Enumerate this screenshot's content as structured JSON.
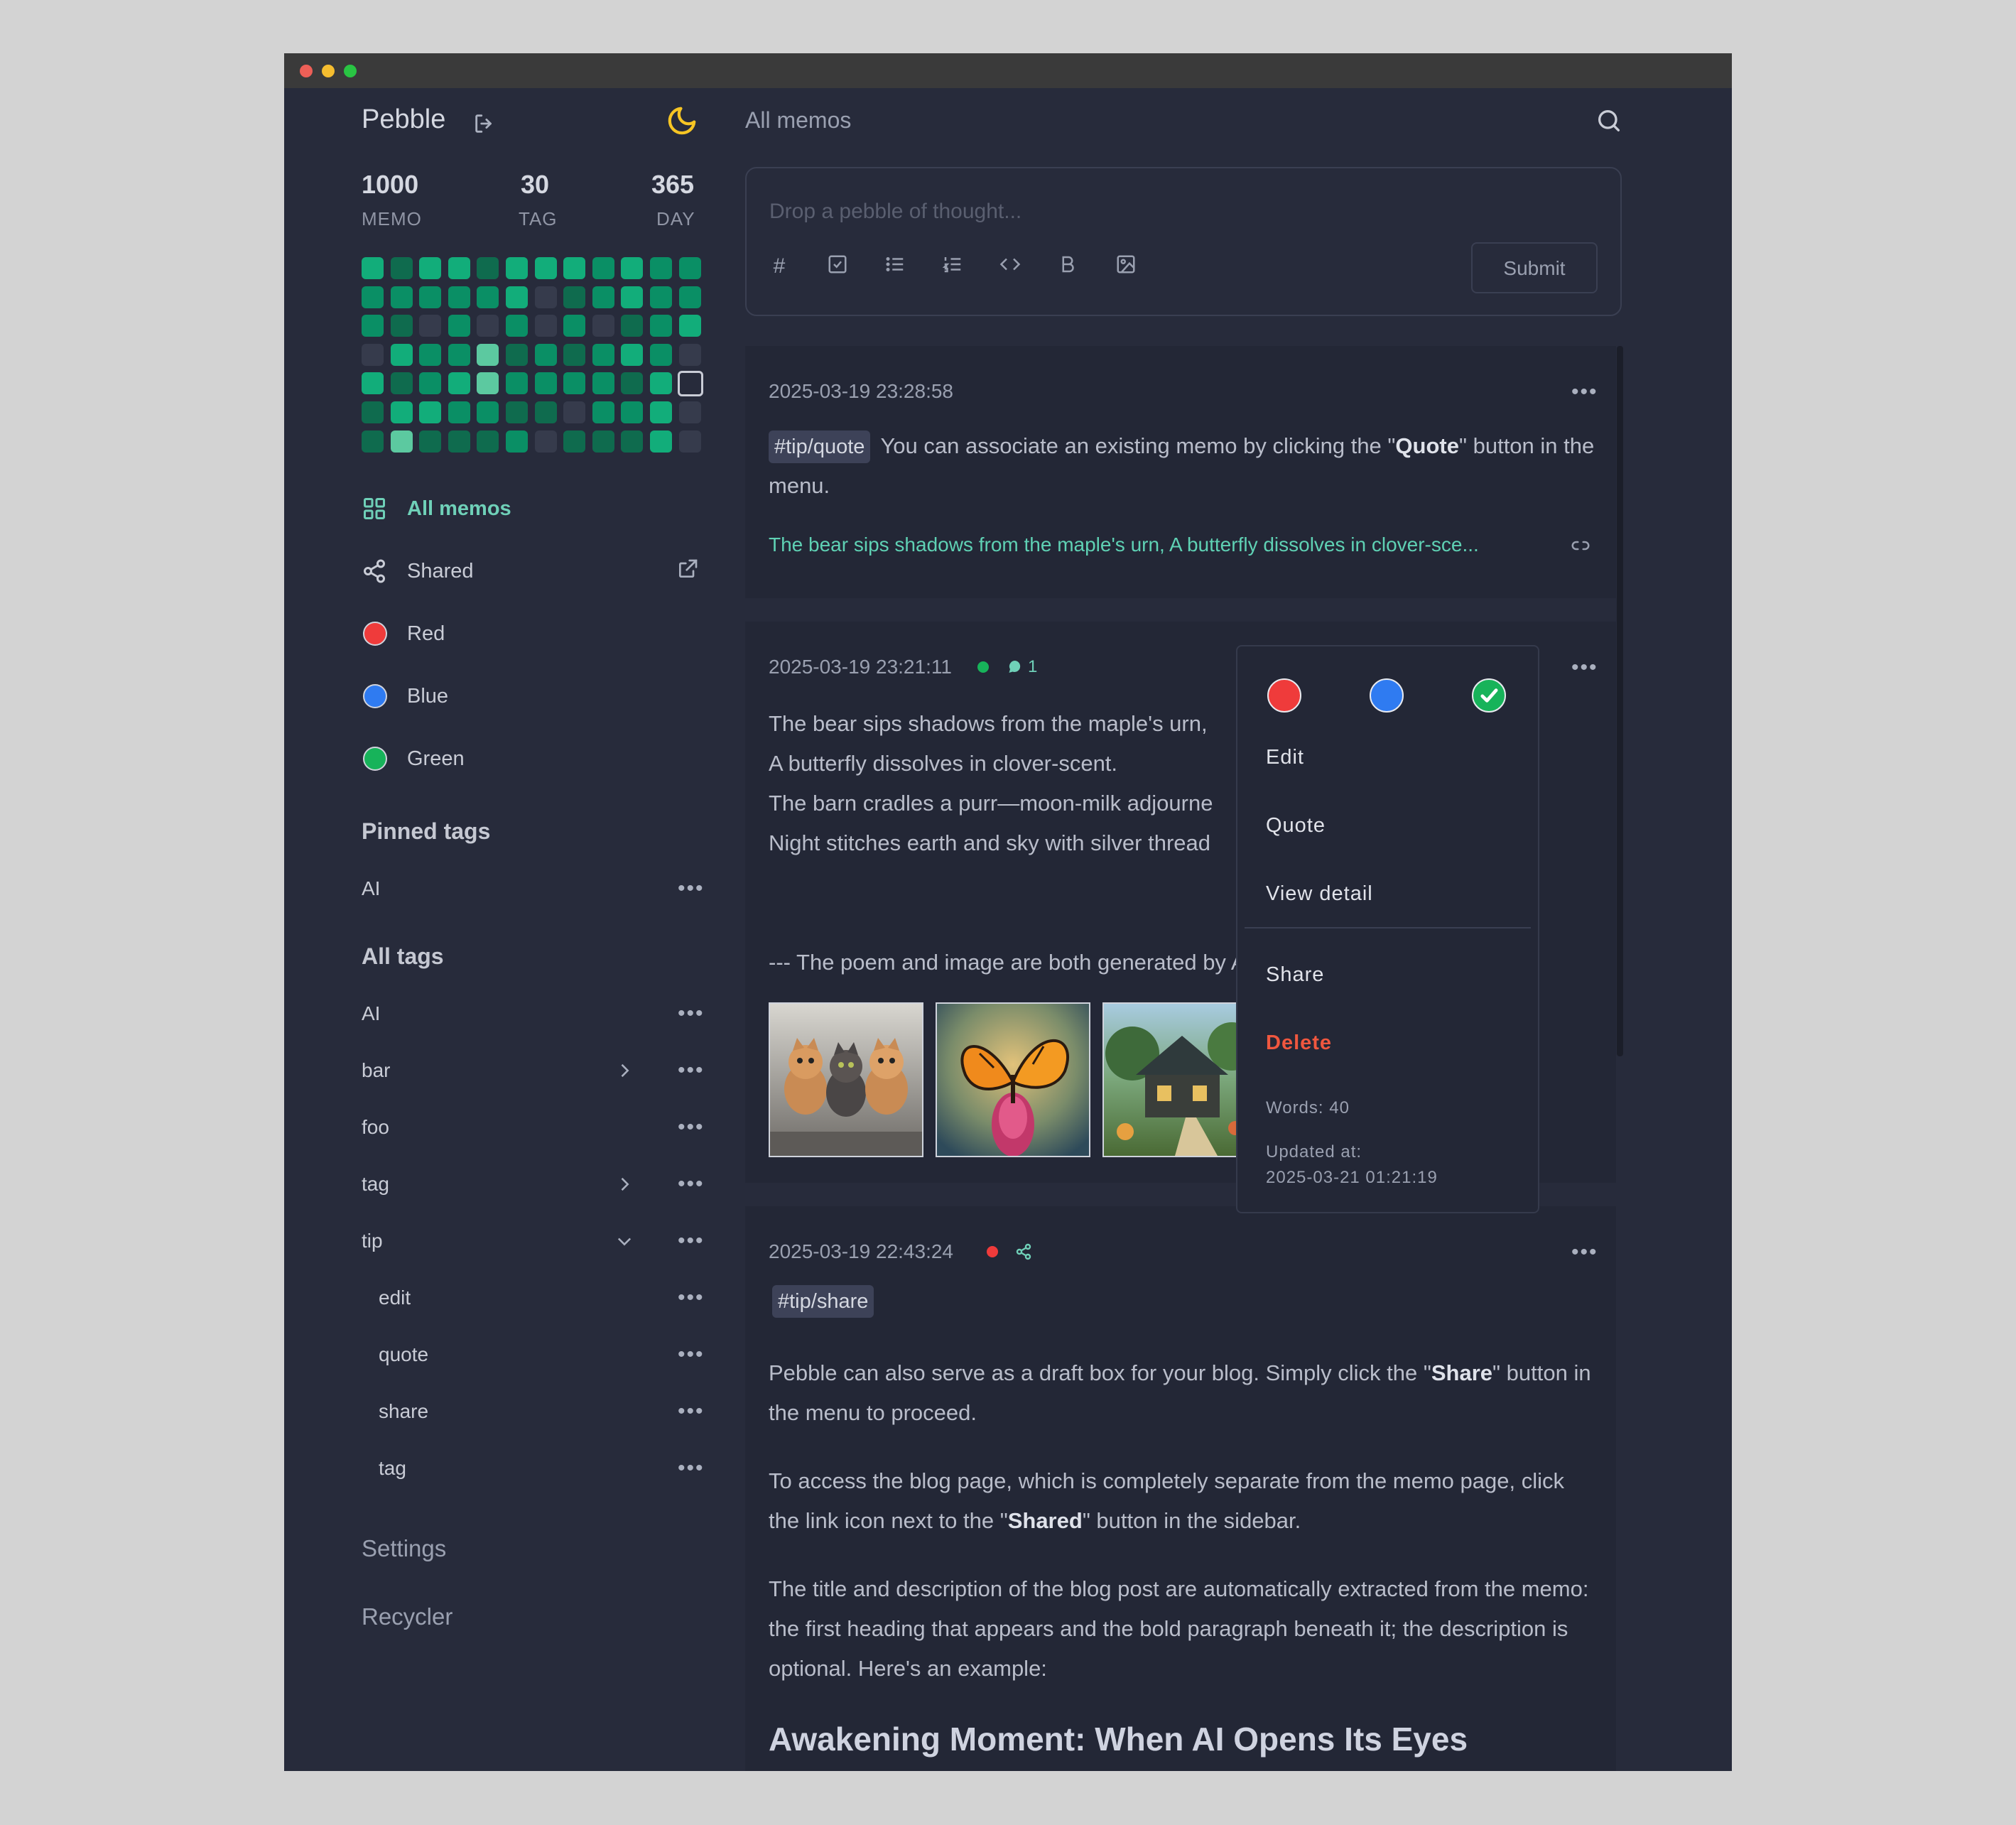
{
  "app": {
    "name": "Pebble"
  },
  "stats": [
    {
      "value": "1000",
      "label": "MEMO"
    },
    {
      "value": "30",
      "label": "TAG"
    },
    {
      "value": "365",
      "label": "DAY"
    }
  ],
  "colors": {
    "red": "#ef3b3b",
    "blue": "#2f7bf1",
    "green": "#17b35a",
    "accent": "#6fd0b8",
    "danger": "#f0573f"
  },
  "heatmap": {
    "columns": 12,
    "rows": 7,
    "levels": [
      [
        3,
        1,
        3,
        3,
        1,
        3,
        3,
        3,
        2,
        3,
        2,
        2
      ],
      [
        2,
        2,
        2,
        2,
        2,
        3,
        0,
        1,
        2,
        3,
        2,
        2
      ],
      [
        2,
        1,
        0,
        2,
        0,
        2,
        0,
        2,
        0,
        1,
        2,
        3
      ],
      [
        0,
        3,
        2,
        2,
        4,
        1,
        2,
        1,
        2,
        3,
        2,
        0
      ],
      [
        3,
        1,
        2,
        3,
        4,
        2,
        2,
        2,
        2,
        1,
        3,
        5
      ],
      [
        1,
        3,
        3,
        2,
        2,
        1,
        1,
        0,
        2,
        2,
        3,
        0
      ],
      [
        1,
        4,
        1,
        1,
        1,
        2,
        0,
        1,
        1,
        1,
        3,
        0
      ]
    ]
  },
  "nav": {
    "all_memos": "All memos",
    "shared": "Shared",
    "red": "Red",
    "blue": "Blue",
    "green": "Green"
  },
  "pinned_tags": {
    "title": "Pinned tags",
    "items": [
      "AI"
    ]
  },
  "all_tags": {
    "title": "All tags",
    "items": [
      "AI",
      "bar",
      "foo",
      "tag",
      "tip"
    ],
    "tip_children": [
      "edit",
      "quote",
      "share",
      "tag"
    ]
  },
  "footer": {
    "settings": "Settings",
    "recycler": "Recycler"
  },
  "main": {
    "title": "All memos",
    "editor_placeholder": "Drop a pebble of thought...",
    "submit_label": "Submit"
  },
  "memos": [
    {
      "timestamp": "2025-03-19 23:28:58",
      "tag": "#tip/quote",
      "text_before": " You can associate an existing memo by clicking the \"",
      "bold": "Quote",
      "text_after": "\" button in the menu.",
      "quote_link": "The bear sips shadows from the maple's urn, A butterfly dissolves in clover-sce..."
    },
    {
      "timestamp": "2025-03-19 23:21:11",
      "comment_count": "1",
      "lines": [
        "The bear sips shadows from the maple's urn,",
        "A butterfly dissolves in clover-scent.",
        "The barn cradles a purr—moon-milk adjourne",
        "Night stitches earth and sky with silver thread"
      ],
      "footer_line": "--- The poem and image are both generated by AI",
      "images": [
        "three kittens",
        "butterfly on flower",
        "cottage in garden"
      ]
    },
    {
      "timestamp": "2025-03-19 22:43:24",
      "tag": "#tip/share",
      "p1_before": "Pebble can also serve as a draft box for your blog. Simply click the \"",
      "p1_bold": "Share",
      "p1_after": "\" button in the menu to proceed.",
      "p2_before": "To access the blog page, which is completely separate from the memo page, click the link icon next to the \"",
      "p2_bold": "Shared",
      "p2_after": "\" button in the sidebar.",
      "p3": "The title and description of the blog post are automatically extracted from the memo: the first heading that appears and the bold paragraph beneath it; the description is optional. Here's an example:",
      "heading": "Awakening Moment: When AI Opens Its Eyes"
    }
  ],
  "menu": {
    "edit": "Edit",
    "quote": "Quote",
    "view_detail": "View detail",
    "share": "Share",
    "delete": "Delete",
    "words": "Words: 40",
    "updated_label": "Updated at:",
    "updated_value": "2025-03-21 01:21:19",
    "selected_color": "green"
  }
}
